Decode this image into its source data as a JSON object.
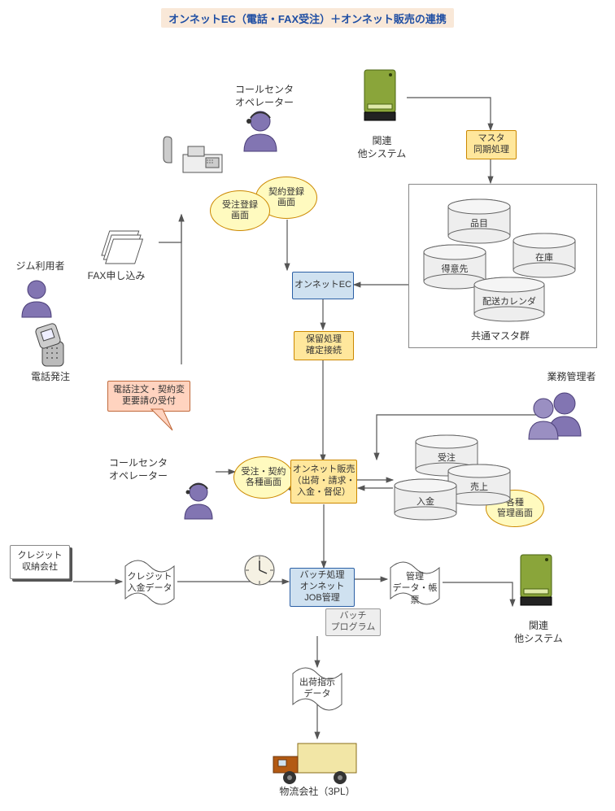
{
  "title": "オンネットEC（電話・FAX受注）＋オンネット販売の連携",
  "actors": {
    "call_center_top": "コールセンタ\nオペレーター",
    "gym_user": "ジム利用者",
    "fax_apply": "FAX申し込み",
    "phone_order": "電話発注",
    "call_center_mid": "コールセンタ\nオペレーター",
    "admin": "業務管理者"
  },
  "systems": {
    "related_top": "関連\n他システム",
    "related_bottom": "関連\n他システム"
  },
  "nodes": {
    "master_sync": "マスタ\n同期処理",
    "contract_register": "契約登録\n画面",
    "order_register": "受注登録\n画面",
    "onnet_ec": "オンネットEC",
    "hold_finalize": "保留処理\n確定接続",
    "phone_note": "電話注文・契約変\n更要請の受付",
    "order_contract_screens": "受注・契約\n各種画面",
    "onnet_sales": "オンネット販売\n（出荷・請求・\n入金・督促）",
    "mgmt_screens": "各種\n管理画面",
    "credit_company": "クレジット\n収納会社",
    "credit_data": "クレジット\n入金データ",
    "batch_job": "バッチ処理\nオンネット\nJOB管理",
    "batch_program": "バッチ\nプログラム",
    "mgmt_report": "管理\nデータ・帳票",
    "ship_data": "出荷指示\nデータ",
    "threepl": "物流会社（3PL）"
  },
  "db_top": {
    "group_label": "共通マスタ群",
    "item": "品目",
    "customer": "得意先",
    "stock": "在庫",
    "calendar": "配送カレンダ"
  },
  "db_mid": {
    "order": "受注",
    "sales": "売上",
    "payment": "入金"
  }
}
